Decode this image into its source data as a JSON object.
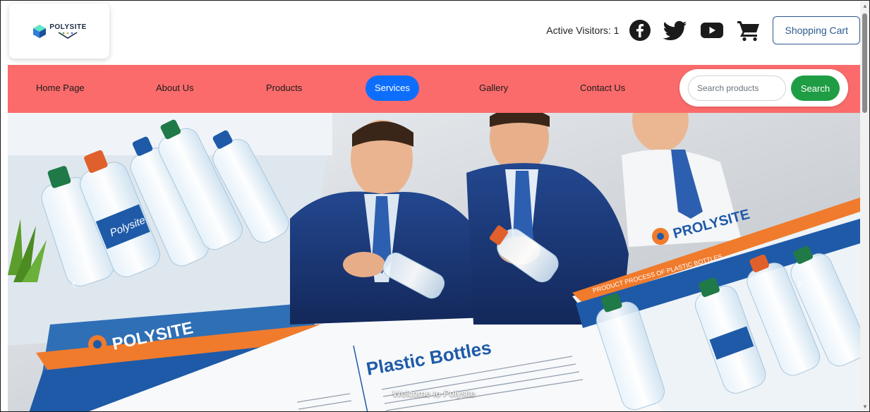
{
  "header": {
    "logo_text": "POLYSITE",
    "visitors_label": "Active Visitors: 1",
    "cart_button": "Shopping Cart",
    "social_icons": [
      "facebook-icon",
      "twitter-icon",
      "youtube-icon",
      "cart-icon"
    ]
  },
  "nav": {
    "items": [
      {
        "label": "Home Page",
        "active": false
      },
      {
        "label": "About Us",
        "active": false
      },
      {
        "label": "Products",
        "active": false
      },
      {
        "label": "Services",
        "active": true
      },
      {
        "label": "Gallery",
        "active": false
      },
      {
        "label": "Contact Us",
        "active": false
      }
    ],
    "search_placeholder": "Search products",
    "search_button": "Search"
  },
  "hero": {
    "caption": "Welcome to Polysite",
    "left_brand": "POLYSITE",
    "right_brand": "PROLYSITE",
    "right_strip": "PRODUCT PROCESS OF PLASTIC BOTTLES",
    "card_title": "Plastic Bottles",
    "bottle_label": "Polysite",
    "prev_glyph": "‹",
    "next_glyph": "›"
  },
  "colors": {
    "nav_bg": "#fb6b6b",
    "active_tab": "#0d6efd",
    "search_button": "#1f9d45",
    "cart_border": "#2d5b8f",
    "facebook": "#1877f2",
    "brand_blue": "#1e5aa8",
    "brand_orange": "#f07b2c"
  }
}
